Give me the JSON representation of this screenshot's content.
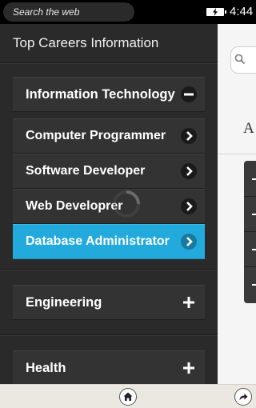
{
  "statusbar": {
    "search_text": "Search the web",
    "time": "4:44"
  },
  "panel": {
    "title": "Top Careers Information",
    "categories": [
      {
        "label": "Information Technology",
        "expanded": true,
        "items": [
          {
            "label": "Computer Programmer",
            "active": false
          },
          {
            "label": "Software Developer",
            "active": false
          },
          {
            "label": "Web Developrer",
            "active": false
          },
          {
            "label": "Database Administrator",
            "active": true
          }
        ]
      },
      {
        "label": "Engineering",
        "expanded": false
      },
      {
        "label": "Health",
        "expanded": false
      }
    ]
  },
  "main": {
    "heading": "A"
  },
  "colors": {
    "accent": "#22aadd",
    "panel_bg": "#2a2a2a",
    "item_bg": "#333333"
  }
}
